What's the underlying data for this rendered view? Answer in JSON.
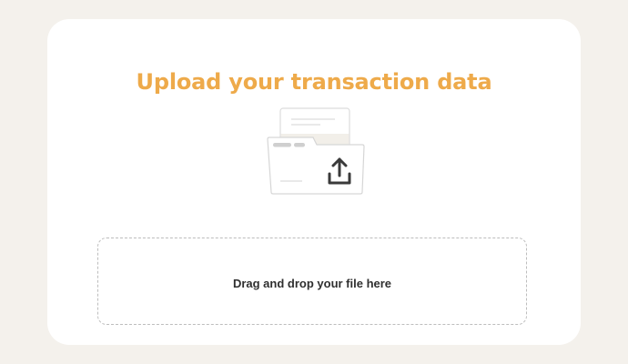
{
  "upload_card": {
    "title": "Upload your transaction data",
    "title_color": "#eeaa4a",
    "illustration_icon": "folder-upload-icon",
    "dropzone": {
      "label": "Drag and drop your file here"
    }
  }
}
